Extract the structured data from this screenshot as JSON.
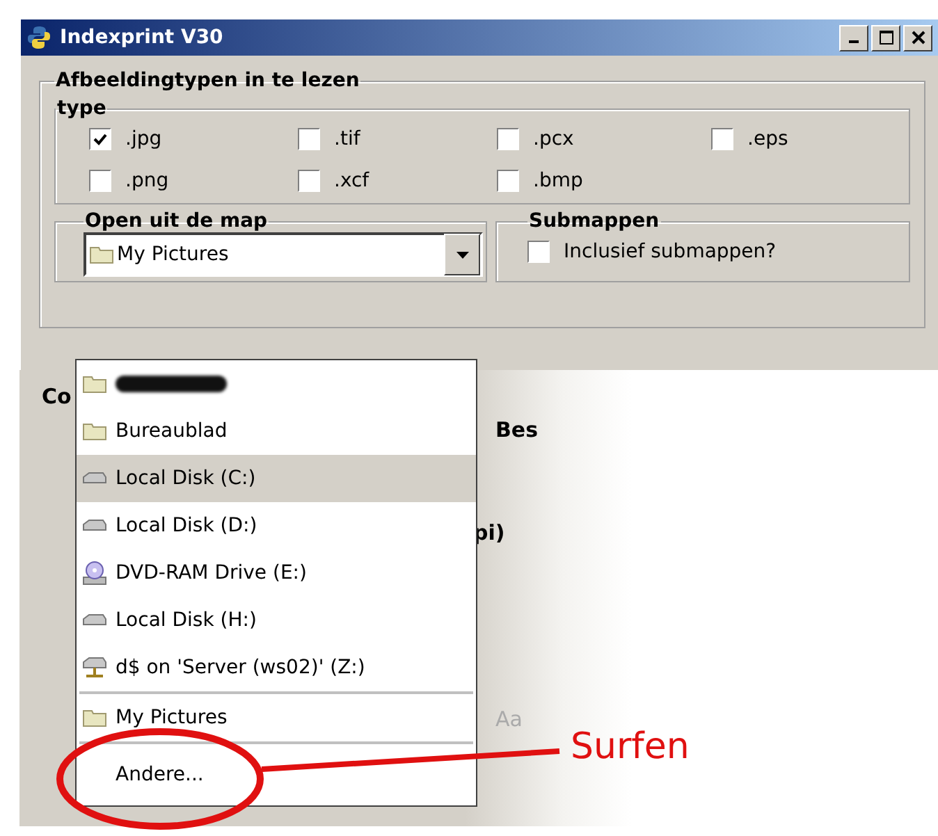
{
  "window": {
    "title": "Indexprint V30"
  },
  "image_types": {
    "label": "Afbeeldingtypen in te lezen",
    "type_group": {
      "label": "type",
      "options": [
        {
          "label": ".jpg",
          "checked": true
        },
        {
          "label": ".tif",
          "checked": false
        },
        {
          "label": ".pcx",
          "checked": false
        },
        {
          "label": ".eps",
          "checked": false
        },
        {
          "label": ".png",
          "checked": false
        },
        {
          "label": ".xcf",
          "checked": false
        },
        {
          "label": ".bmp",
          "checked": false
        }
      ]
    }
  },
  "folder": {
    "label": "Open uit de map",
    "value": "My Pictures",
    "dropdown": {
      "sections": [
        [
          {
            "kind": "redacted",
            "selected": false
          },
          {
            "kind": "folder",
            "label": "Bureaublad",
            "selected": false
          },
          {
            "kind": "disk",
            "label": "Local Disk (C:)",
            "selected": true
          },
          {
            "kind": "disk",
            "label": "Local Disk (D:)",
            "selected": false
          },
          {
            "kind": "dvd",
            "label": "DVD-RAM Drive (E:)",
            "selected": false
          },
          {
            "kind": "disk",
            "label": "Local Disk (H:)",
            "selected": false
          },
          {
            "kind": "network",
            "label": "d$ on 'Server (ws02)' (Z:)",
            "selected": false
          }
        ],
        [
          {
            "kind": "folder",
            "label": "My Pictures",
            "selected": false
          }
        ],
        [
          {
            "kind": "other",
            "label": "Andere...",
            "selected": false
          }
        ]
      ]
    }
  },
  "submappen": {
    "label": "Submappen",
    "option": {
      "label": "Inclusief submappen?",
      "checked": false
    }
  },
  "background_fragments": [
    "Co",
    "Bes",
    "pi)",
    "Aa"
  ],
  "annotation": {
    "label": "Surfen"
  }
}
